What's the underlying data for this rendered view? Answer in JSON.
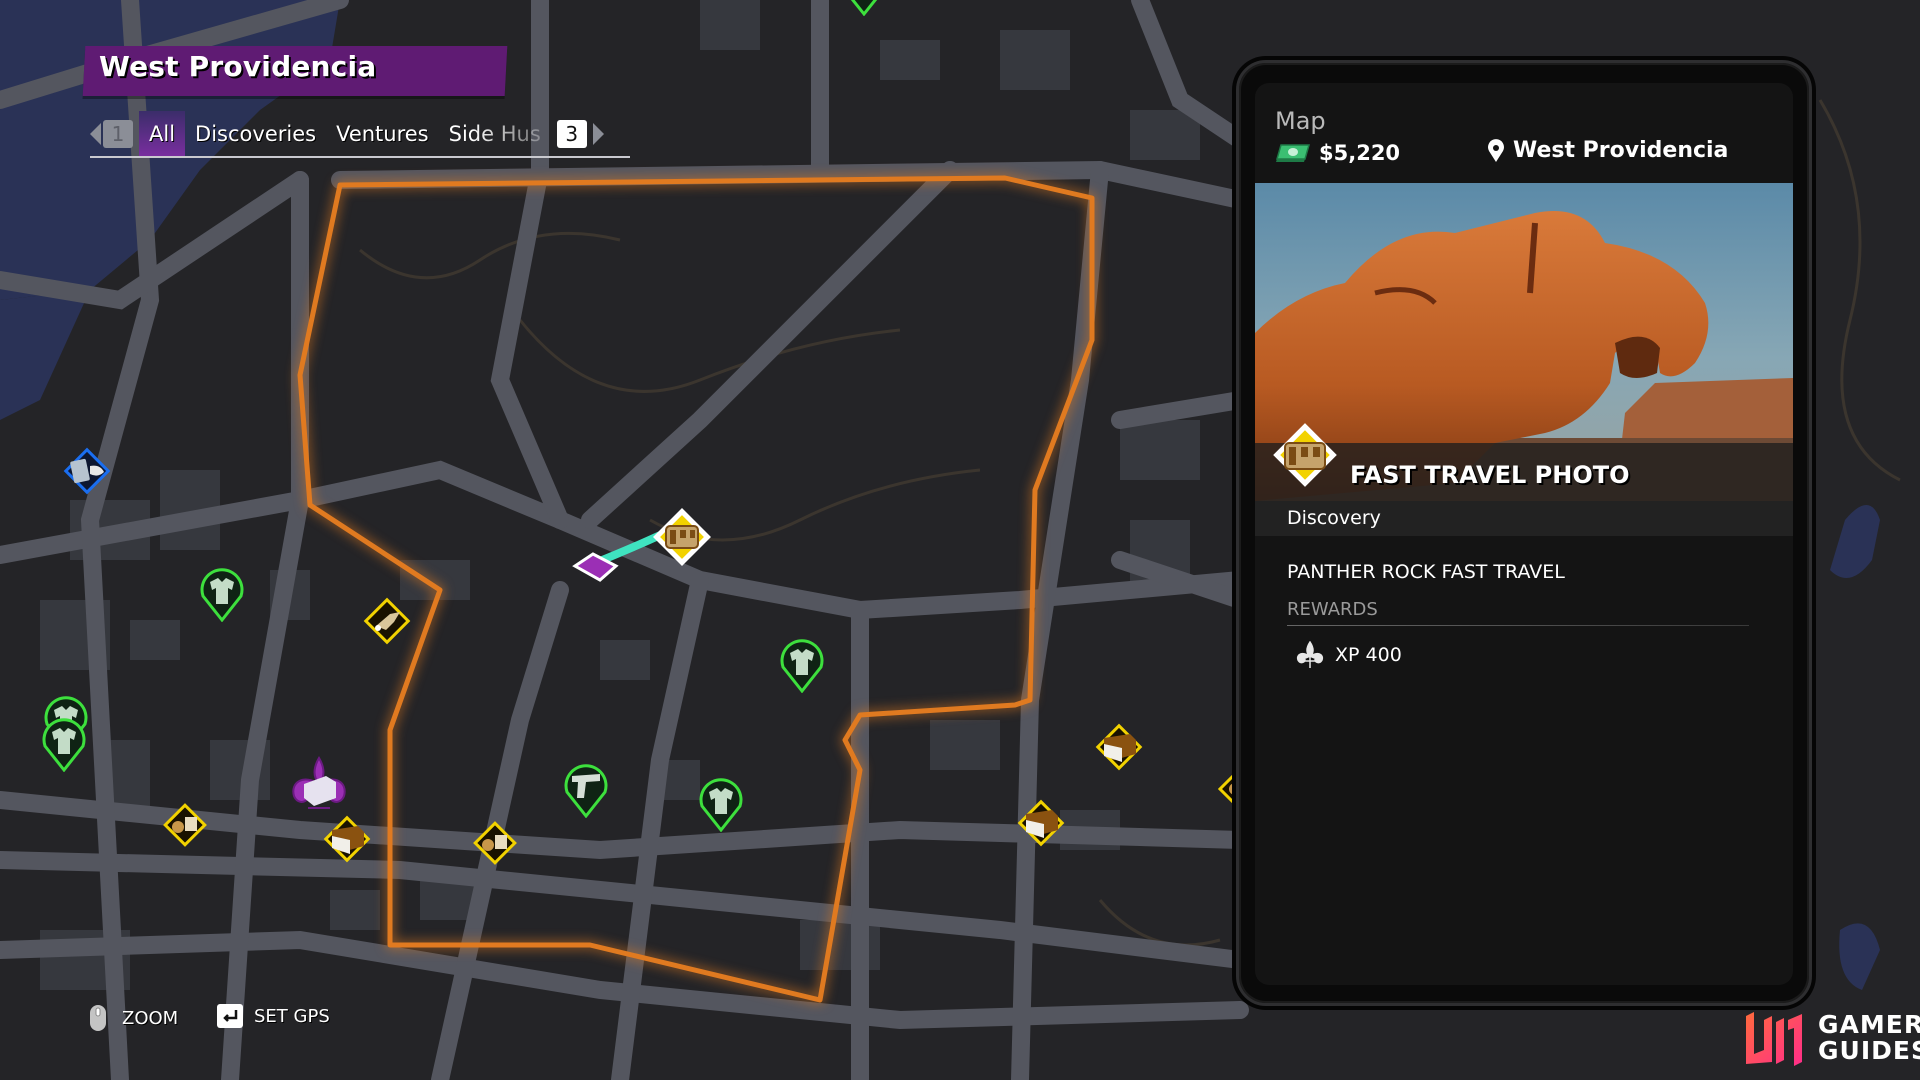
{
  "header": {
    "region_title": "West Providencia"
  },
  "tabs": {
    "prev_key": "1",
    "next_key": "3",
    "items": [
      {
        "label": "All",
        "active": true
      },
      {
        "label": "Discoveries",
        "active": false
      },
      {
        "label": "Ventures",
        "active": false
      },
      {
        "label": "Side Hus",
        "active": false
      }
    ]
  },
  "hints": {
    "zoom_label": "ZOOM",
    "gps_label": "SET GPS"
  },
  "panel": {
    "title": "Map",
    "money": "$5,220",
    "location": "West Providencia",
    "photo_title": "FAST TRAVEL PHOTO",
    "category": "Discovery",
    "mission_name": "PANTHER ROCK FAST TRAVEL",
    "rewards_label": "REWARDS",
    "rewards": [
      {
        "icon": "fleur-de-lis-icon",
        "text": "XP 400"
      }
    ]
  },
  "map": {
    "district_outline_color": "#e07a20",
    "gps_route_color": "#3fe3c0",
    "player_marker_color": "#9b2fb5",
    "markers": [
      {
        "type": "fast-travel-photo",
        "selected": true
      },
      {
        "type": "clothing-store"
      },
      {
        "type": "clothing-store"
      },
      {
        "type": "clothing-store"
      },
      {
        "type": "clothing-store"
      },
      {
        "type": "clothing-store"
      },
      {
        "type": "clothing-store"
      },
      {
        "type": "weapon-store"
      },
      {
        "type": "photo-collectible"
      },
      {
        "type": "photo-collectible"
      },
      {
        "type": "cache-box"
      },
      {
        "type": "cache-box"
      },
      {
        "type": "cache-box"
      },
      {
        "type": "saints-hq"
      },
      {
        "type": "ventures-contact"
      },
      {
        "type": "mission-star"
      }
    ]
  },
  "watermark": {
    "line1": "GAMER",
    "line2": "GUIDES"
  }
}
